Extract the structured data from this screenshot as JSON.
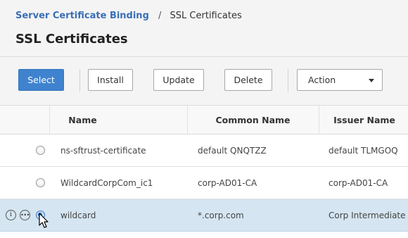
{
  "breadcrumb": {
    "parent": "Server Certificate Binding",
    "separator": "/",
    "current": "SSL Certificates"
  },
  "page": {
    "title": "SSL Certificates"
  },
  "toolbar": {
    "select_label": "Select",
    "install_label": "Install",
    "update_label": "Update",
    "delete_label": "Delete",
    "action_label": "Action"
  },
  "table": {
    "columns": [
      "Name",
      "Common Name",
      "Issuer Name"
    ],
    "rows": [
      {
        "name": "ns-sftrust-certificate",
        "common_name": "default QNQTZZ",
        "issuer_name": "default TLMGOQ",
        "selected": false
      },
      {
        "name": "WildcardCorpCom_ic1",
        "common_name": "corp-AD01-CA",
        "issuer_name": "corp-AD01-CA",
        "selected": false
      },
      {
        "name": "wildcard",
        "common_name": "*.corp.com",
        "issuer_name": "Corp Intermediate",
        "selected": true
      }
    ]
  },
  "icons": {
    "info": "info-icon",
    "more": "more-icon",
    "caret": "chevron-down-icon",
    "cursor": "mouse-pointer-icon"
  },
  "colors": {
    "primary_button": "#3f83cf",
    "link": "#3a6fb5",
    "selected_row": "#d5e5f1"
  }
}
